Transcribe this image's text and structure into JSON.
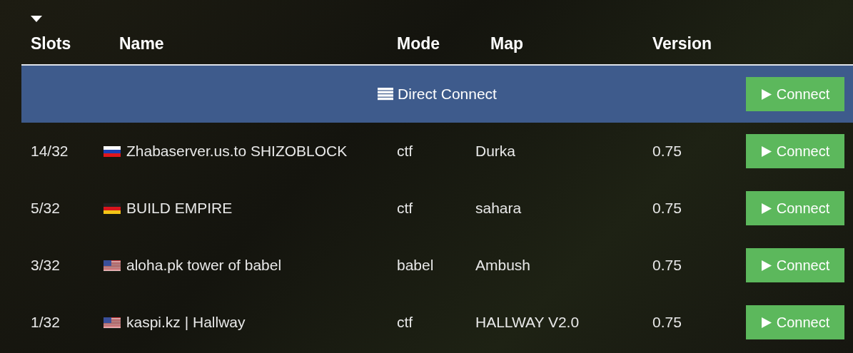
{
  "table": {
    "columns": [
      "Slots",
      "Name",
      "Mode",
      "Map",
      "Version"
    ],
    "direct_connect": {
      "label": "Direct Connect",
      "button": "Connect"
    },
    "rows": [
      {
        "slots": "14/32",
        "kind": "ru",
        "name": "Zhabaserver.us.to SHIZOBLOCK",
        "mode": "ctf",
        "map": "Durka",
        "version": "0.75",
        "button": "Connect"
      },
      {
        "slots": "5/32",
        "kind": "de",
        "name": "BUILD EMPIRE",
        "mode": "ctf",
        "map": "sahara",
        "version": "0.75",
        "button": "Connect"
      },
      {
        "slots": "3/32",
        "kind": "us",
        "name": "aloha.pk tower of babel",
        "mode": "babel",
        "map": "Ambush",
        "version": "0.75",
        "button": "Connect"
      },
      {
        "slots": "1/32",
        "kind": "us",
        "name": "kaspi.kz | Hallway",
        "mode": "ctf",
        "map": "HALLWAY V2.0",
        "version": "0.75",
        "button": "Connect"
      }
    ]
  }
}
